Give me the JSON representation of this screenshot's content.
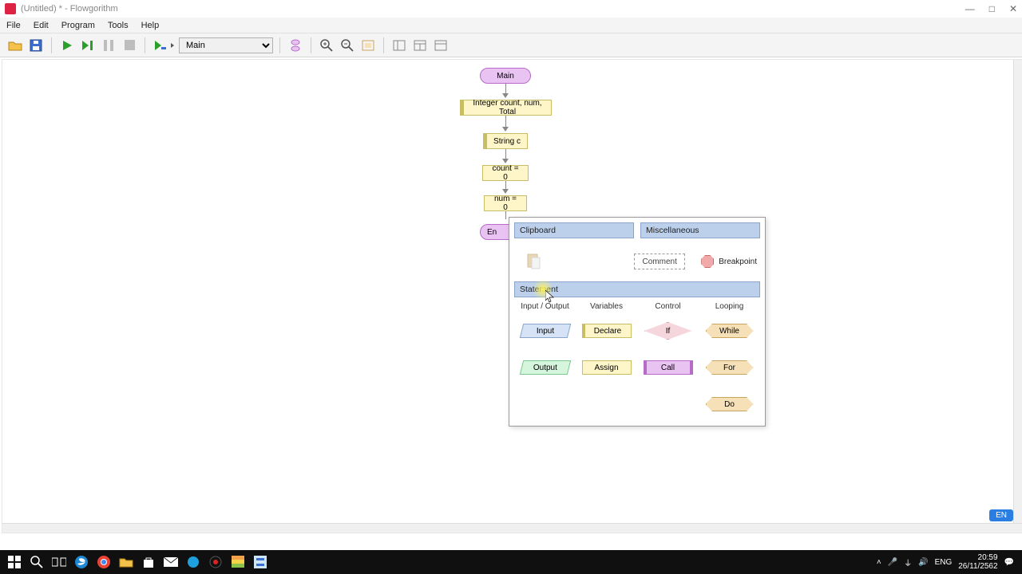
{
  "titlebar": {
    "title": "(Untitled) * - Flowgorithm"
  },
  "menu": {
    "file": "File",
    "edit": "Edit",
    "program": "Program",
    "tools": "Tools",
    "help": "Help"
  },
  "toolbar": {
    "func_selected": "Main"
  },
  "flow": {
    "main": "Main",
    "decl1": "Integer count, num, Total",
    "decl2": "String c",
    "asn1": "count = 0",
    "asn2": "num = 0",
    "end_partial": "En"
  },
  "panel": {
    "clipboard": "Clipboard",
    "misc": "Miscellaneous",
    "comment": "Comment",
    "breakpoint": "Breakpoint",
    "statement": "Statement",
    "cols": {
      "io": "Input / Output",
      "vars": "Variables",
      "ctrl": "Control",
      "loop": "Looping"
    },
    "shapes": {
      "input": "Input",
      "output": "Output",
      "declare": "Declare",
      "assign": "Assign",
      "if": "If",
      "call": "Call",
      "while": "While",
      "for": "For",
      "do": "Do"
    }
  },
  "lang_badge": "EN",
  "tb": {
    "lang": "ENG",
    "time": "20:59",
    "date": "26/11/2562"
  }
}
